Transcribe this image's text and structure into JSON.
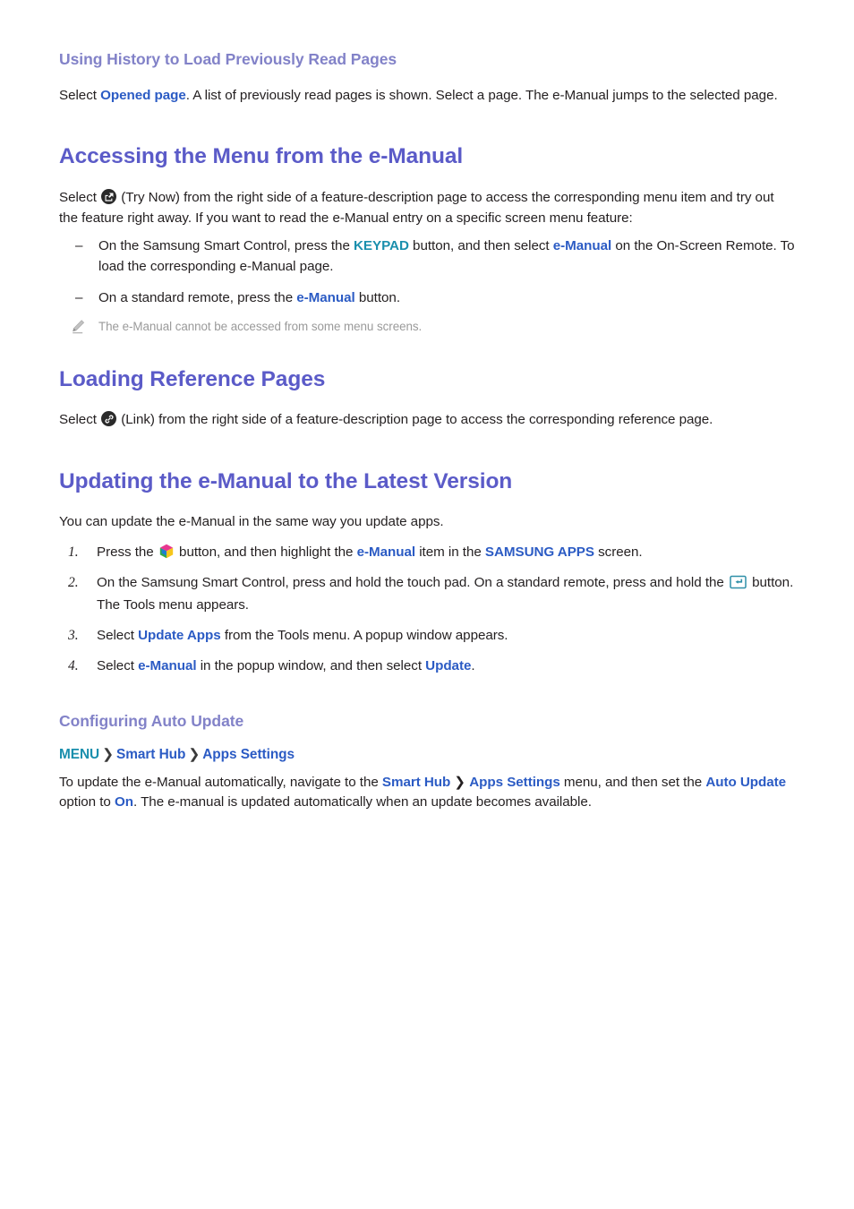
{
  "colors": {
    "h1": "#5b5bc8",
    "h2": "#8282c8",
    "body_text": "#231f20",
    "link_blue": "#2b5bc4",
    "link_teal": "#1a8fad",
    "note_gray": "#9a9a9a"
  },
  "section_history": {
    "heading": "Using History to Load Previously Read Pages",
    "para": {
      "t1": "Select ",
      "link1": "Opened page",
      "t2": ". A list of previously read pages is shown. Select a page. The e-Manual jumps to the selected page."
    }
  },
  "section_accessing": {
    "heading": "Accessing the Menu from the e-Manual",
    "intro": {
      "t1": "Select ",
      "icon": "try-now-icon",
      "t2": " (Try Now) from the right side of a feature-description page to access the corresponding menu item and try out the feature right away. If you want to read the e-Manual entry on a specific screen menu feature:"
    },
    "bullets": [
      {
        "marker": "–",
        "t1": "On the Samsung Smart Control, press the ",
        "link1": "KEYPAD",
        "t2": " button, and then select ",
        "link2": "e-Manual",
        "t3": " on the On-Screen Remote. To load the corresponding e-Manual page."
      },
      {
        "marker": "–",
        "t1": "On a standard remote, press the ",
        "link1": "e-Manual",
        "t2": " button.",
        "t3": ""
      }
    ],
    "note": {
      "icon": "pencil-icon",
      "text": "The e-Manual cannot be accessed from some menu screens."
    }
  },
  "section_reference": {
    "heading": "Loading Reference Pages",
    "para": {
      "t1": "Select ",
      "icon": "link-icon",
      "t2": " (Link) from the right side of a feature-description page to access the corresponding reference page."
    }
  },
  "section_updating": {
    "heading": "Updating the e-Manual to the Latest Version",
    "intro": "You can update the e-Manual in the same way you update apps.",
    "steps": [
      {
        "num": "1.",
        "t1": "Press the ",
        "icon": "smart-hub-icon",
        "t2": " button, and then highlight the ",
        "link1": "e-Manual",
        "t3": " item in the ",
        "link2": "SAMSUNG APPS",
        "t4": " screen."
      },
      {
        "num": "2.",
        "t1": "On the Samsung Smart Control, press and hold the touch pad. On a standard remote, press and hold the ",
        "icon": "enter-key-icon",
        "t2": " button. The Tools menu appears.",
        "link1": "",
        "t3": "",
        "link2": "",
        "t4": ""
      },
      {
        "num": "3.",
        "t1": "Select ",
        "link1": "Update Apps",
        "t2": " from the Tools menu. A popup window appears.",
        "t3": "",
        "link2": "",
        "t4": ""
      },
      {
        "num": "4.",
        "t1": "Select ",
        "link1": "e-Manual",
        "t2": " in the popup window, and then select ",
        "link2": "Update",
        "t3": ".",
        "t4": ""
      }
    ]
  },
  "section_autoupdate": {
    "heading": "Configuring Auto Update",
    "menu_path": {
      "root": "MENU",
      "sep1": "❯",
      "item1": "Smart Hub",
      "sep2": "❯",
      "item2": "Apps Settings"
    },
    "para": {
      "t1": "To update the e-Manual automatically, navigate to the ",
      "link1": "Smart Hub",
      "sep": " ❯ ",
      "link2": "Apps Settings",
      "t2": " menu, and then set the ",
      "link3": "Auto Update",
      "t3": " option to ",
      "link4": "On",
      "t4": ". The e-manual is updated automatically when an update becomes available."
    }
  }
}
